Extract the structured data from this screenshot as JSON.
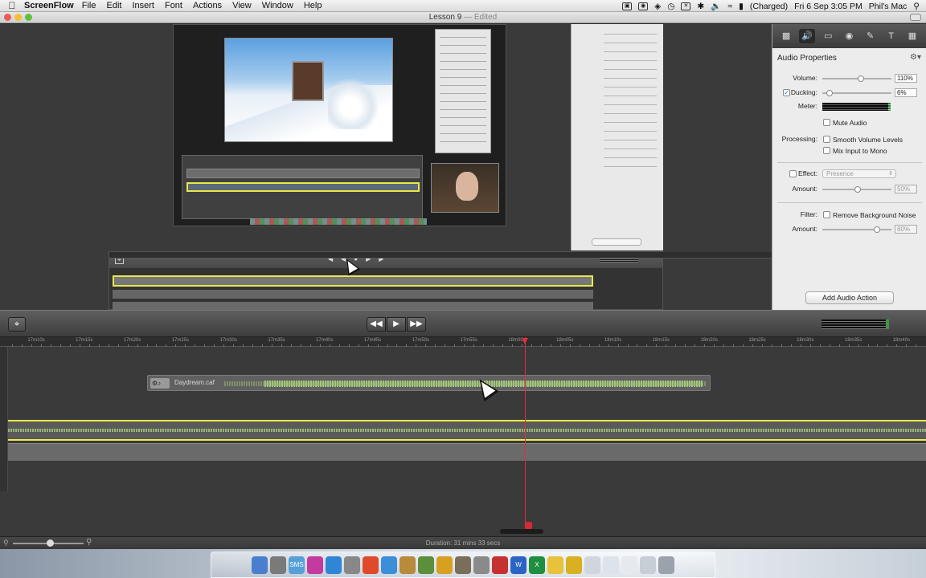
{
  "menubar": {
    "app": "ScreenFlow",
    "items": [
      "File",
      "Edit",
      "Insert",
      "Font",
      "Actions",
      "View",
      "Window",
      "Help"
    ],
    "battery": "(Charged)",
    "datetime": "Fri 6 Sep  3:05 PM",
    "user": "Phil's Mac"
  },
  "window": {
    "title": "Lesson 9",
    "title_suffix": " — Edited"
  },
  "panel": {
    "tabs": [
      "video-tab",
      "audio-tab",
      "screen-tab",
      "callout-tab",
      "annotation-tab",
      "text-tab",
      "media-tab"
    ],
    "active_tab": "audio-tab",
    "title": "Audio Properties",
    "volume_label": "Volume:",
    "volume_value": "110%",
    "volume_level": 0.55,
    "ducking_label": "Ducking:",
    "ducking_checked": true,
    "ducking_value": "6%",
    "ducking_level": 0.06,
    "meter_label": "Meter:",
    "mute_label": "Mute Audio",
    "processing_label": "Processing:",
    "smooth_label": "Smooth Volume Levels",
    "mono_label": "Mix Input to Mono",
    "effect_label": "Effect:",
    "effect_value": "Presence",
    "amount_label": "Amount:",
    "effect_amount": "50%",
    "effect_amount_level": 0.5,
    "filter_label": "Filter:",
    "filter_option": "Remove Background Noise",
    "filter_amount": "80%",
    "filter_amount_level": 0.8,
    "add_action": "Add Audio Action"
  },
  "ruler": {
    "ticks": [
      "17m10s",
      "17m15s",
      "17m20s",
      "17m25s",
      "17m30s",
      "17m35s",
      "17m40s",
      "17m45s",
      "17m50s",
      "17m55s",
      "18m00s",
      "18m05s",
      "18m10s",
      "18m15s",
      "18m20s",
      "18m25s",
      "18m30s",
      "18m35s",
      "18m40s"
    ]
  },
  "clips": {
    "music_name": "Daydream.caf"
  },
  "status": {
    "duration": "Duration: 31 mins 33 secs"
  },
  "dock": {
    "apps": [
      {
        "label": "",
        "color": "#4a7fd0"
      },
      {
        "label": "",
        "color": "#7a7a7a"
      },
      {
        "label": "SMS",
        "color": "#55a0d8"
      },
      {
        "label": "",
        "color": "#c33aa0"
      },
      {
        "label": "",
        "color": "#2f86d6"
      },
      {
        "label": "",
        "color": "#888888"
      },
      {
        "label": "",
        "color": "#e04a2b"
      },
      {
        "label": "",
        "color": "#3b8fd8"
      },
      {
        "label": "",
        "color": "#b88a3c"
      },
      {
        "label": "",
        "color": "#5c8f3a"
      },
      {
        "label": "",
        "color": "#d8a020"
      },
      {
        "label": "",
        "color": "#7a6e5a"
      },
      {
        "label": "",
        "color": "#8a8a8a"
      },
      {
        "label": "",
        "color": "#c63030"
      },
      {
        "label": "W",
        "color": "#2a64c4"
      },
      {
        "label": "X",
        "color": "#1f8f3f"
      },
      {
        "label": "",
        "color": "#e7c23a"
      },
      {
        "label": "",
        "color": "#d8b020"
      },
      {
        "label": "",
        "color": "#cfd6de"
      },
      {
        "label": "",
        "color": "#dde3ea"
      },
      {
        "label": "",
        "color": "#e6e9ed"
      },
      {
        "label": "",
        "color": "#c8ced6"
      },
      {
        "label": "",
        "color": "#9aa2ac"
      }
    ]
  }
}
